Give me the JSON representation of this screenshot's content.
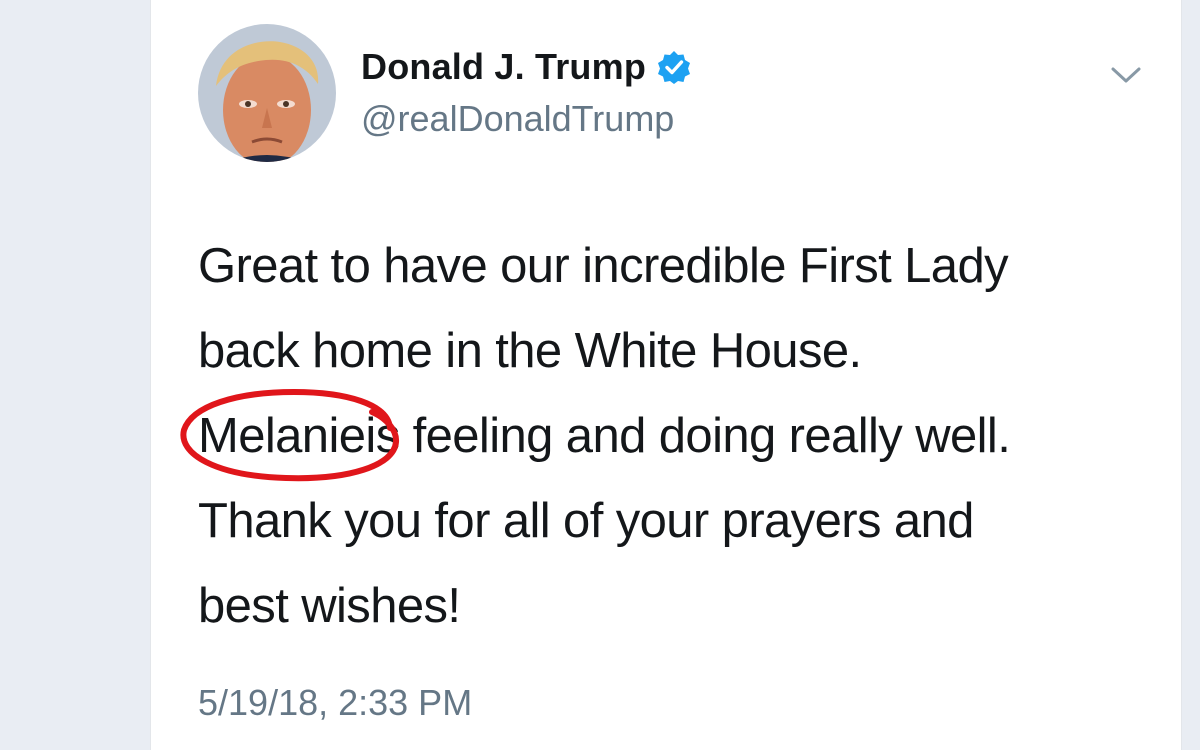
{
  "tweet": {
    "author": {
      "display_name": "Donald J. Trump",
      "handle": "@realDonaldTrump",
      "verified": true
    },
    "text_lines": [
      "Great to have our incredible First Lady",
      "back home in the White House.",
      "Melanie",
      "is feeling and doing really well.",
      "Thank you for all of your prayers and",
      "best wishes!"
    ],
    "timestamp": "5/19/18, 2:33 PM"
  },
  "icons": {
    "verified": "verified-badge-icon",
    "menu": "chevron-down-icon"
  },
  "annotation": {
    "type": "red-ellipse",
    "color": "#e0161b",
    "target": "Melanie"
  },
  "colors": {
    "verified_blue": "#1da1f2",
    "text": "#14171a",
    "secondary_text": "#657786"
  }
}
